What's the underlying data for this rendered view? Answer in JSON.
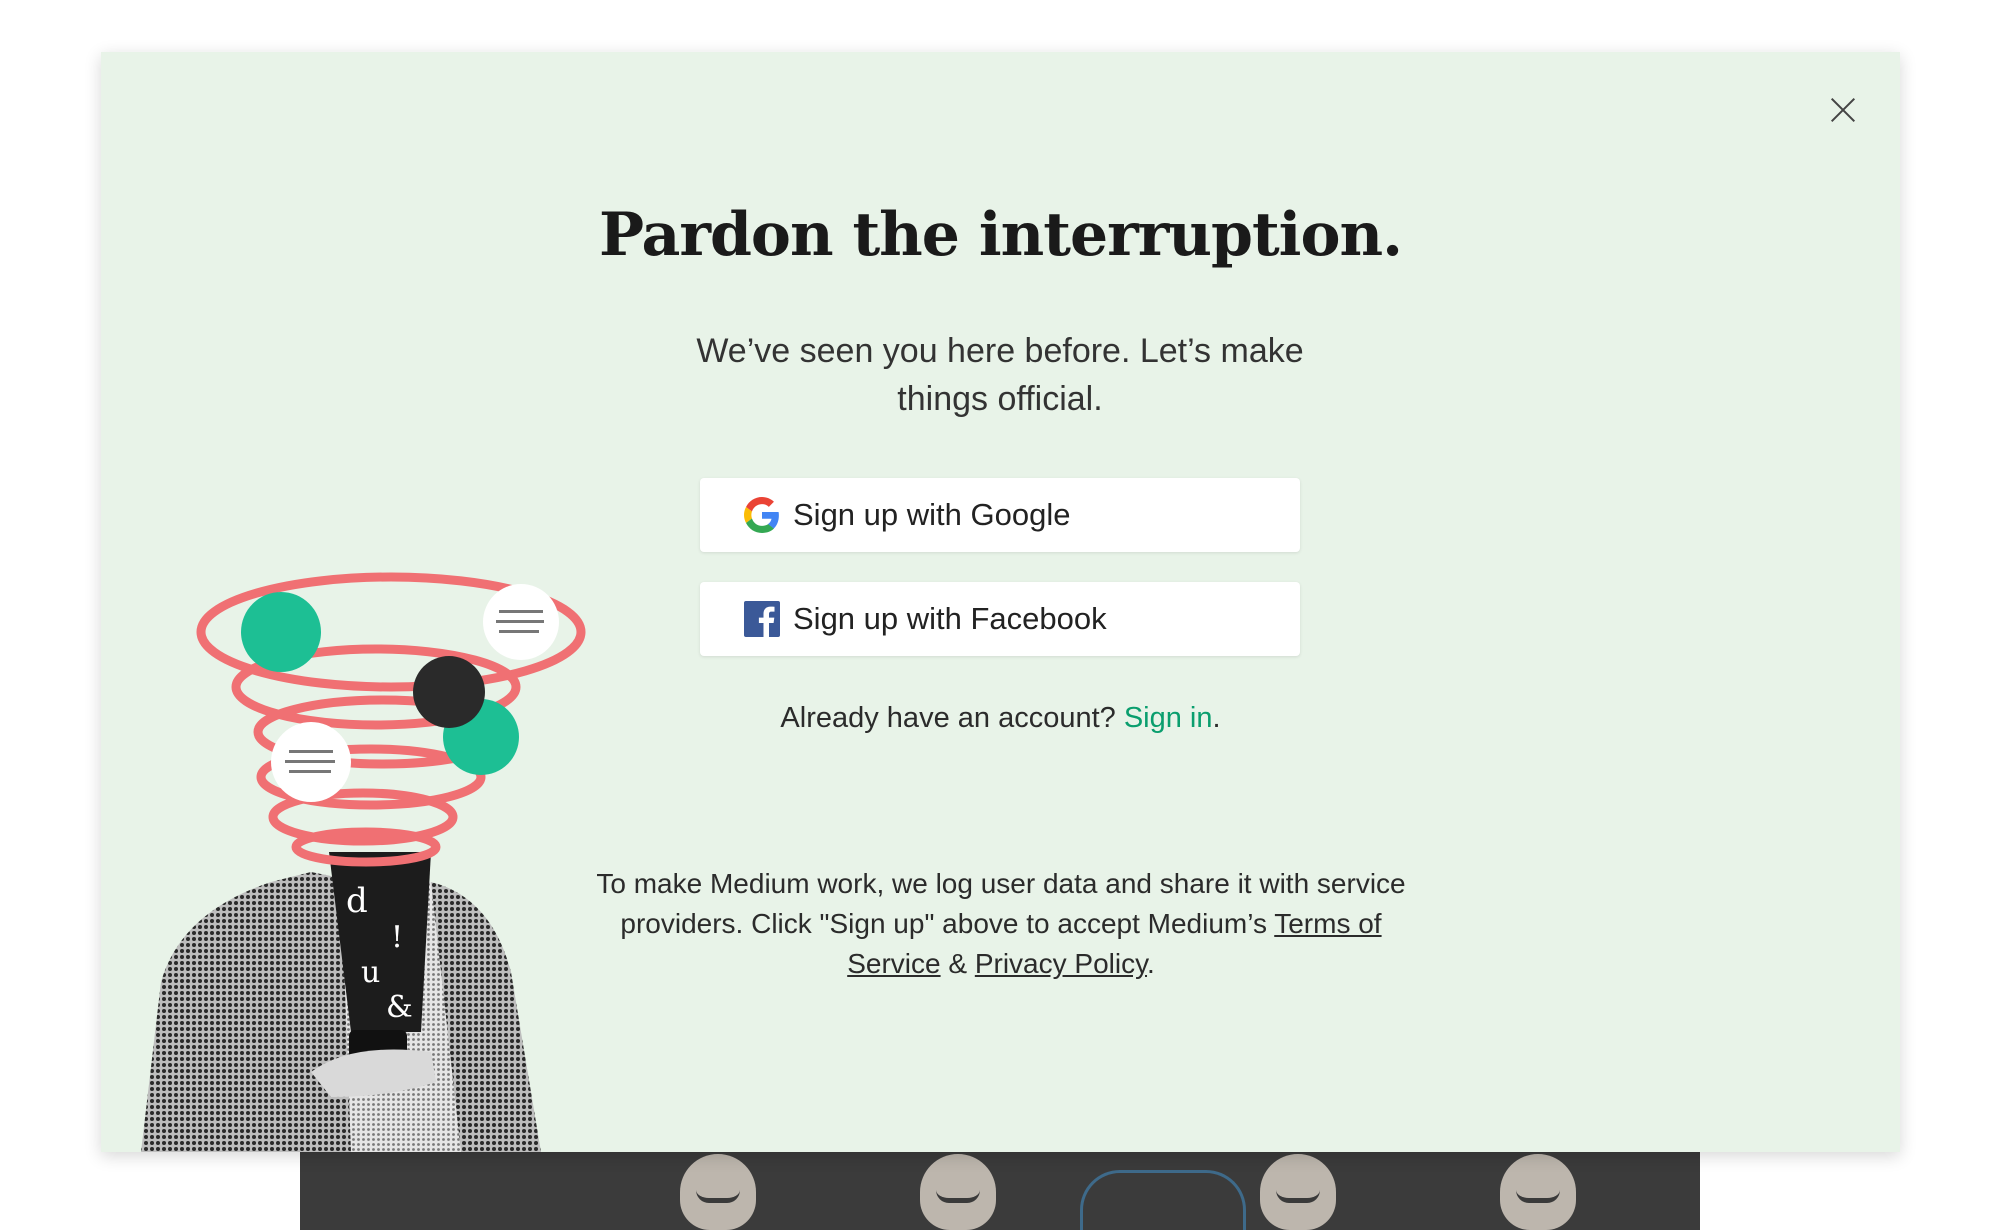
{
  "modal": {
    "title": "Pardon the interruption.",
    "subtitle": "We’ve seen you here before. Let’s make things official.",
    "google_button": "Sign up with Google",
    "facebook_button": "Sign up with Facebook",
    "signin_prompt": "Already have an account?",
    "signin_link": "Sign in",
    "signin_suffix": ".",
    "legal_text": "To make Medium work, we log user data and share it with service providers. Click \"Sign up\" above to accept Medium’s",
    "terms_link": "Terms of Service",
    "legal_and": "&",
    "privacy_link": "Privacy Policy",
    "legal_suffix": "."
  },
  "colors": {
    "modal_bg": "#e8f3e8",
    "accent_green": "#0a9e6e",
    "facebook_blue": "#3b5998",
    "swirl_red": "#f07073",
    "dot_teal": "#1dbf94"
  },
  "icons": [
    "close-icon",
    "google-icon",
    "facebook-icon"
  ]
}
